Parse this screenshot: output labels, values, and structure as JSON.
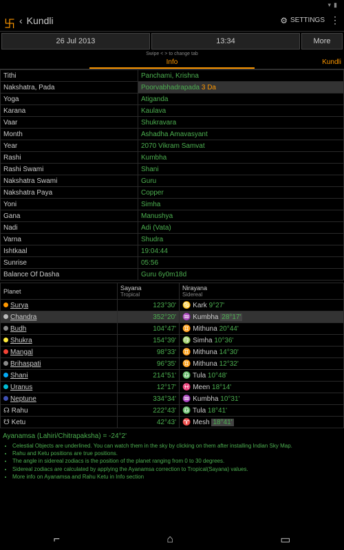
{
  "status": {
    "time": ""
  },
  "appbar": {
    "title": "Kundli",
    "settings": "SETTINGS"
  },
  "toolbar": {
    "date": "26 Jul 2013",
    "time": "13:34",
    "more": "More"
  },
  "swipe_hint": "Swipe < > to change tab",
  "tabs": {
    "active": "Info",
    "next": "Kundli"
  },
  "info": [
    {
      "k": "Tithi",
      "v": "Panchami, Krishna"
    },
    {
      "k": "Nakshatra, Pada",
      "v": "Poorvabhadrapada",
      "suffix": "3 Da",
      "hl": true
    },
    {
      "k": "Yoga",
      "v": "Atiganda"
    },
    {
      "k": "Karana",
      "v": "Kaulava"
    },
    {
      "k": "Vaar",
      "v": "Shukravara"
    },
    {
      "k": "Month",
      "v": "Ashadha Amavasyant"
    },
    {
      "k": "Year",
      "v": "2070 Vikram Samvat"
    },
    {
      "k": "Rashi",
      "v": "Kumbha"
    },
    {
      "k": "Rashi Swami",
      "v": "Shani"
    },
    {
      "k": "Nakshatra Swami",
      "v": "Guru"
    },
    {
      "k": "Nakshatra Paya",
      "v": "Copper"
    },
    {
      "k": "Yoni",
      "v": "Simha"
    },
    {
      "k": "Gana",
      "v": "Manushya"
    },
    {
      "k": "Nadi",
      "v": "Adi (Vata)"
    },
    {
      "k": "Varna",
      "v": "Shudra"
    },
    {
      "k": "Ishtkaal",
      "v": "19:04:44"
    },
    {
      "k": "Sunrise",
      "v": "05:56"
    },
    {
      "k": "Balance Of Dasha",
      "v": "Guru 6y0m18d"
    }
  ],
  "planet_headers": {
    "c0": "Planet",
    "c1": "Sayana",
    "c1sub": "Tropical",
    "c2": "Nirayana",
    "c2sub": "Sidereal"
  },
  "planets": [
    {
      "dot": "#ff9800",
      "name": "Surya",
      "trop": "123°30'",
      "sign": "♋ Kark",
      "deg": "9°27'"
    },
    {
      "dot": "#bbb",
      "name": "Chandra",
      "trop": "352°20'",
      "sign": "♒ Kumbha",
      "deg": "28°17'",
      "hl": true,
      "deg_hl": true
    },
    {
      "dot": "#888",
      "name": "Budh",
      "trop": "104°47'",
      "sign": "♊ Mithuna",
      "deg": "20°44'"
    },
    {
      "dot": "#ffeb3b",
      "name": "Shukra",
      "trop": "154°39'",
      "sign": "♍ Simha",
      "deg": "10°36'"
    },
    {
      "dot": "#f44336",
      "name": "Mangal",
      "trop": "98°33'",
      "sign": "♊ Mithuna",
      "deg": "14°30'"
    },
    {
      "dot": "#888",
      "name": "Brihaspati",
      "trop": "96°35'",
      "sign": "♊ Mithuna",
      "deg": "12°32'"
    },
    {
      "dot": "#03a9f4",
      "name": "Shani",
      "trop": "214°51'",
      "sign": "♎ Tula",
      "deg": "10°48'"
    },
    {
      "dot": "#00bcd4",
      "name": "Uranus",
      "trop": "12°17'",
      "sign": "♓ Meen",
      "deg": "18°14'"
    },
    {
      "dot": "#3f51b5",
      "name": "Neptune",
      "trop": "334°34'",
      "sign": "♒ Kumbha",
      "deg": "10°31'"
    },
    {
      "sym": "☊",
      "name": "Rahu",
      "no_ul": true,
      "trop": "222°43'",
      "sign": "♎ Tula",
      "deg": "18°41'"
    },
    {
      "sym": "☋",
      "name": "Ketu",
      "no_ul": true,
      "trop": "42°43'",
      "sign": "♈ Mesh",
      "deg": "18°41'",
      "deg_hl": true
    }
  ],
  "ayanamsa": "Ayanamsa (Lahiri/Chitrapaksha) = -24°2'",
  "bullets": [
    "Celestial Objects are underlined. You can watch them in the sky by clicking on them after installing Indian Sky Map.",
    "Rahu and Ketu positions are true positions.",
    "The angle in sidereal zodiacs is the position of the planet ranging from 0 to 30 degrees.",
    "Sidereal zodiacs are calculated by applying the Ayanamsa correction to Tropical(Sayana) values.",
    "More info on Ayanamsa and Rahu Ketu in Info section"
  ]
}
